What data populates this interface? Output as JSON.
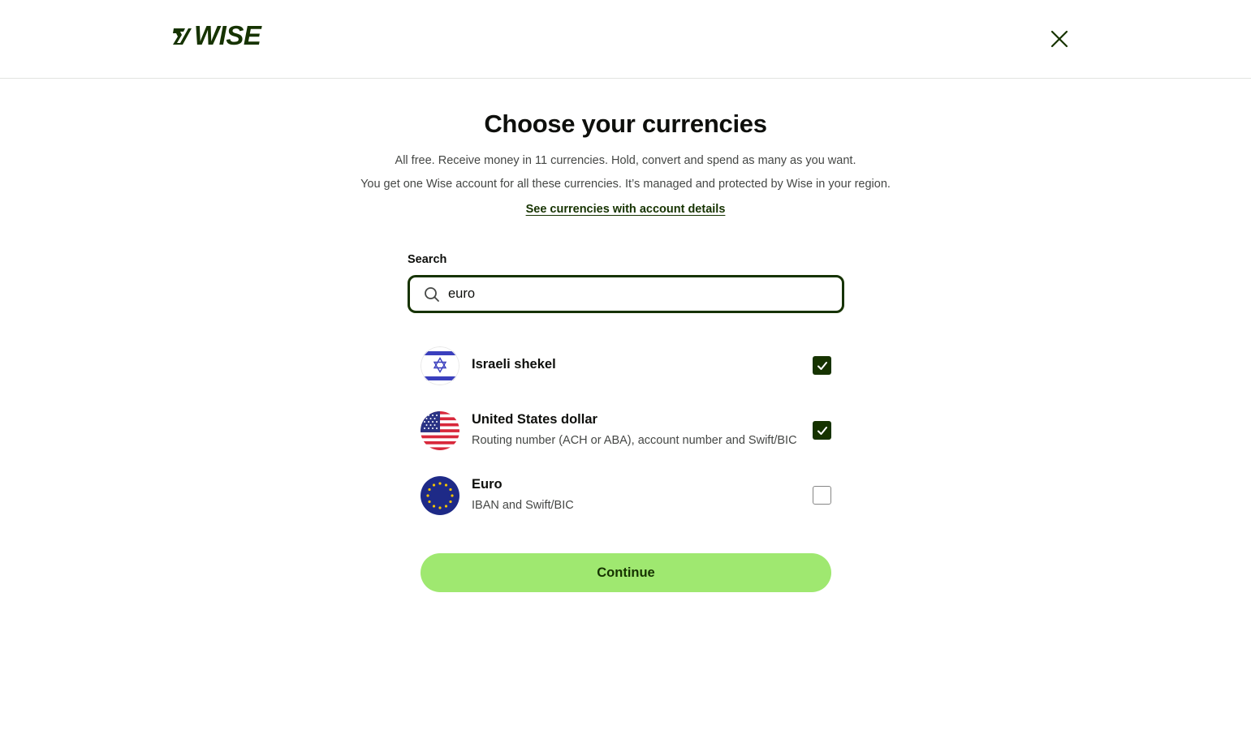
{
  "header": {
    "logo_text": "WISE",
    "close_label": "Close"
  },
  "page": {
    "title": "Choose your currencies",
    "subtitle_line1": "All free. Receive money in 11 currencies. Hold, convert and spend as many as you want.",
    "subtitle_line2": "You get one Wise account for all these currencies. It’s managed and protected by Wise in your region.",
    "details_link": "See currencies with account details"
  },
  "search": {
    "label": "Search",
    "value": "euro",
    "icon": "search-icon"
  },
  "currencies": [
    {
      "name": "Israeli shekel",
      "details": "",
      "checked": true,
      "flag": "israel-flag-icon"
    },
    {
      "name": "United States dollar",
      "details": "Routing number (ACH or ABA), account number and Swift/BIC",
      "checked": true,
      "flag": "usa-flag-icon"
    },
    {
      "name": "Euro",
      "details": "IBAN and Swift/BIC",
      "checked": false,
      "flag": "eu-flag-icon"
    }
  ],
  "actions": {
    "continue_label": "Continue"
  },
  "colors": {
    "brand_dark_green": "#163300",
    "brand_bright_green": "#9fe870",
    "text_primary": "#0e0f0c",
    "text_secondary": "#454745"
  }
}
